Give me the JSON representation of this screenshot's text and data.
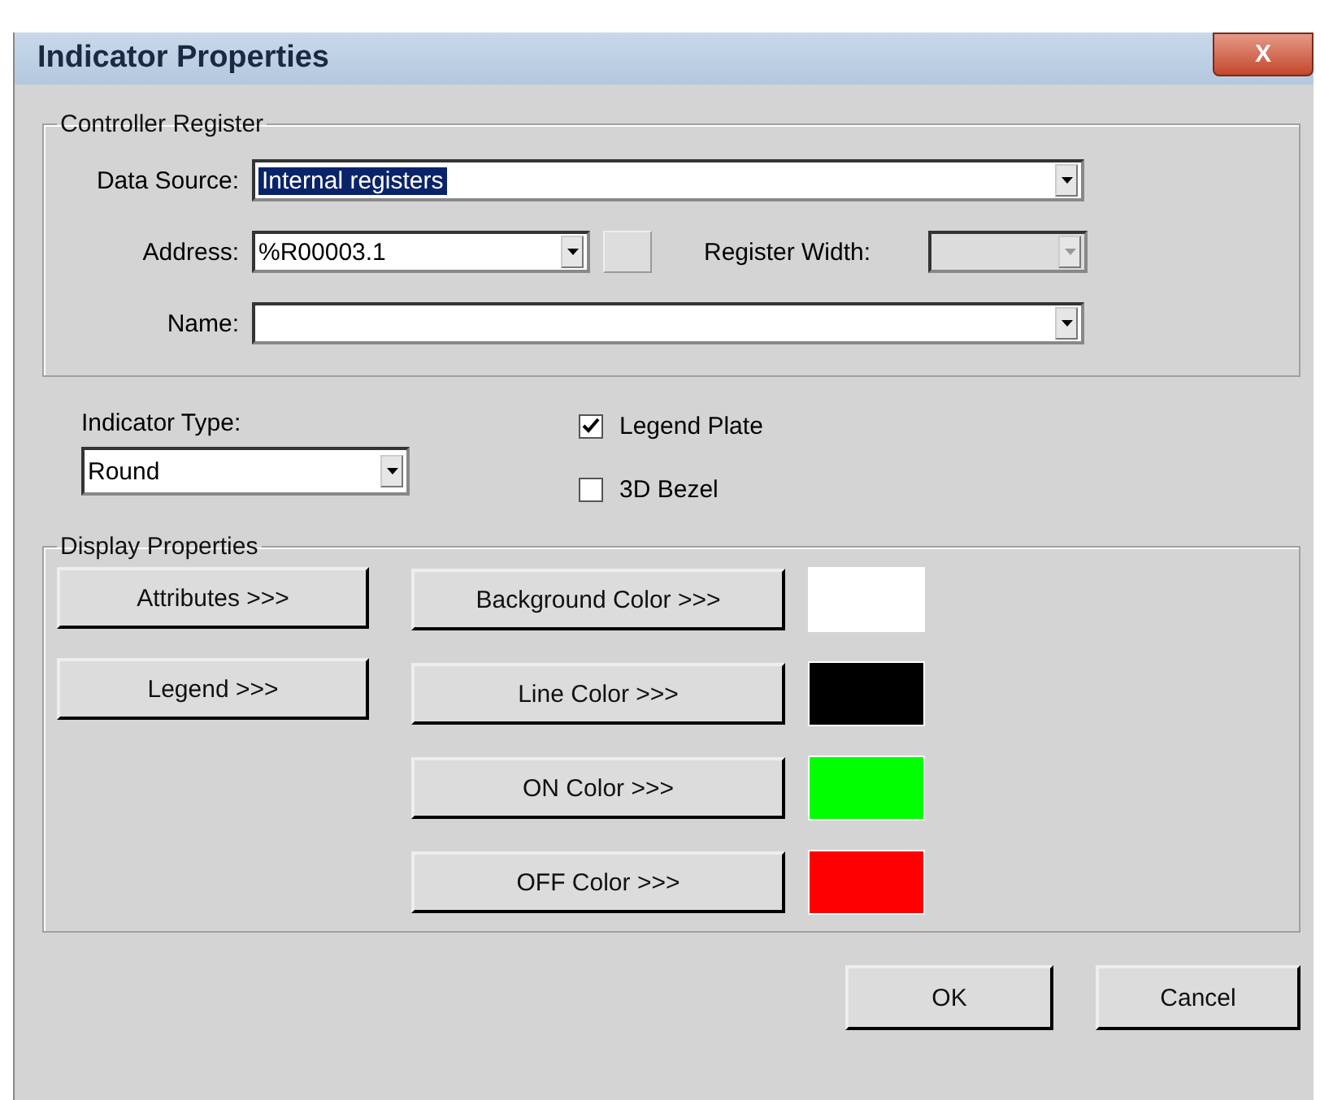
{
  "window": {
    "title": "Indicator Properties",
    "close": "X"
  },
  "controller_register": {
    "legend": "Controller Register",
    "data_source": {
      "label": "Data Source:",
      "value": "Internal registers"
    },
    "address": {
      "label": "Address:",
      "value": "%R00003.1"
    },
    "register_width": {
      "label": "Register Width:",
      "disabled": true
    },
    "name": {
      "label": "Name:"
    }
  },
  "indicator_type": {
    "label": "Indicator Type:",
    "value": "Round"
  },
  "checkboxes": [
    {
      "label": "Legend Plate",
      "checked": true
    },
    {
      "label": "3D Bezel",
      "checked": false
    }
  ],
  "display_properties": {
    "legend": "Display Properties",
    "left_buttons": [
      "Attributes >>>",
      "Legend >>>"
    ],
    "color_buttons": [
      {
        "label": "Background Color >>>",
        "color": "#ffffff"
      },
      {
        "label": "Line Color >>>",
        "color": "#000000"
      },
      {
        "label": "ON Color >>>",
        "color": "#00ff00"
      },
      {
        "label": "OFF Color >>>",
        "color": "#ff0000"
      }
    ]
  },
  "buttons": [
    "OK",
    "Cancel"
  ]
}
